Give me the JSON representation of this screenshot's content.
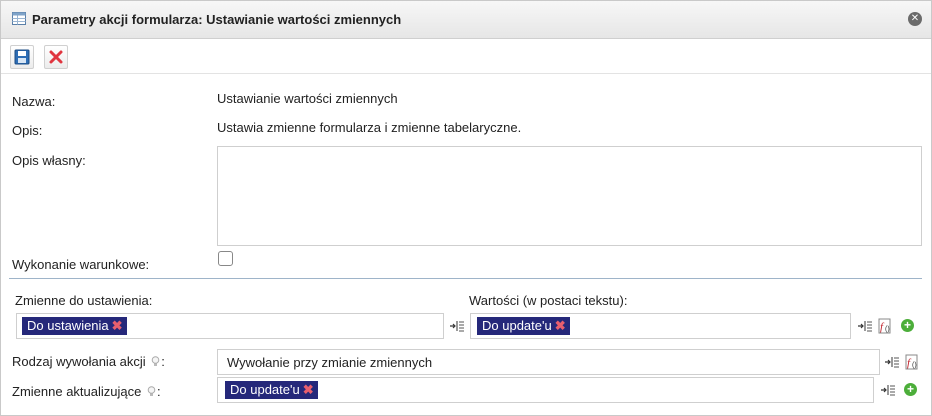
{
  "window": {
    "title": "Parametry akcji formularza: Ustawianie wartości zmiennych",
    "title_icon": "table-window-icon",
    "close_icon": "close-icon"
  },
  "toolbar": {
    "save_icon": "save-icon",
    "cancel_icon": "cancel-icon"
  },
  "form": {
    "name_label": "Nazwa:",
    "name_value": "Ustawianie wartości zmiennych",
    "desc_label": "Opis:",
    "desc_value": "Ustawia zmienne formularza i zmienne tabelaryczne.",
    "custom_desc_label": "Opis własny:",
    "custom_desc_value": "",
    "conditional_label": "Wykonanie warunkowe:",
    "conditional_checked": false
  },
  "variables": {
    "label": "Zmienne do ustawienia:",
    "tags": [
      "Do ustawienia"
    ]
  },
  "values": {
    "label": "Wartości (w postaci tekstu):",
    "tags": [
      "Do update'u"
    ]
  },
  "call_type": {
    "label": "Rodzaj wywołania akcji",
    "value": "Wywołanie przy zmianie zmiennych"
  },
  "updating_vars": {
    "label": "Zmienne aktualizujące",
    "tags": [
      "Do update'u"
    ]
  },
  "colors": {
    "tag_bg": "#25287a",
    "tag_remove": "#e85f6e",
    "add_green": "#4cae3a",
    "separator": "#9eb4c9"
  },
  "symbols": {
    "remove_x": "✖",
    "plus": "+",
    "colon": ":"
  }
}
